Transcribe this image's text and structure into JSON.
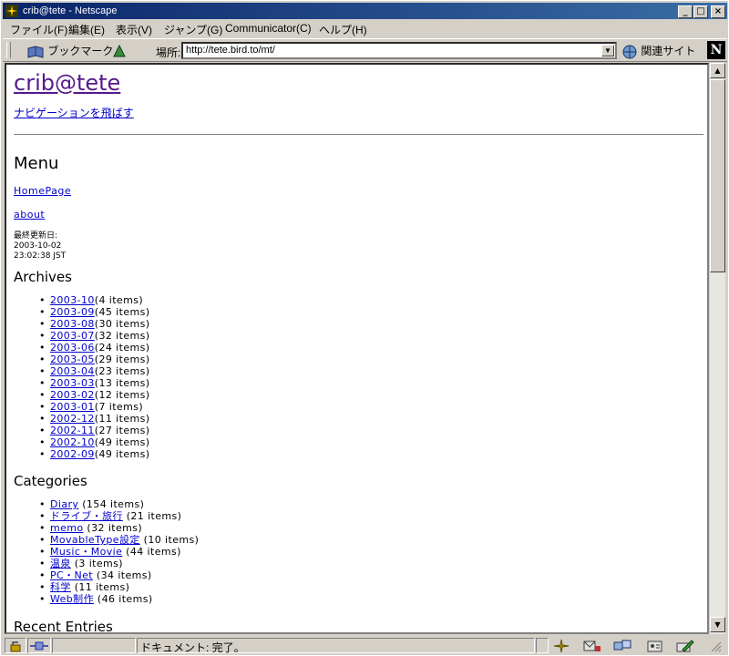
{
  "window": {
    "title": "crib@tete - Netscape"
  },
  "menubar": [
    "ファイル(F)",
    "編集(E)",
    "表示(V)",
    "ジャンプ(G)",
    "Communicator(C)",
    "ヘルプ(H)"
  ],
  "toolbar": {
    "bookmarks_label": "ブックマーク",
    "location_label": "場所:",
    "url": "http://tete.bird.to/mt/",
    "related_label": "関連サイト"
  },
  "page": {
    "site_title": "crib@tete",
    "skip_nav": "ナビゲーションを飛ばす",
    "menu_heading": "Menu",
    "menu_links": [
      "HomePage",
      "about"
    ],
    "last_updated_label": "最終更新日:",
    "last_updated_date": "2003-10-02",
    "last_updated_time": "23:02:38 JST",
    "archives_heading": "Archives",
    "archives": [
      {
        "label": "2003-10",
        "count": "(4 items)"
      },
      {
        "label": "2003-09",
        "count": "(45 items)"
      },
      {
        "label": "2003-08",
        "count": "(30 items)"
      },
      {
        "label": "2003-07",
        "count": "(32 items)"
      },
      {
        "label": "2003-06",
        "count": "(24 items)"
      },
      {
        "label": "2003-05",
        "count": "(29 items)"
      },
      {
        "label": "2003-04",
        "count": "(23 items)"
      },
      {
        "label": "2003-03",
        "count": "(13 items)"
      },
      {
        "label": "2003-02",
        "count": "(12 items)"
      },
      {
        "label": "2003-01",
        "count": "(7 items)"
      },
      {
        "label": "2002-12",
        "count": "(11 items)"
      },
      {
        "label": "2002-11",
        "count": "(27 items)"
      },
      {
        "label": "2002-10",
        "count": "(49 items)"
      },
      {
        "label": "2002-09",
        "count": "(49 items)"
      }
    ],
    "categories_heading": "Categories",
    "categories": [
      {
        "label": "Diary",
        "count": " (154 items)"
      },
      {
        "label": "ドライブ・旅行",
        "count": " (21 items)"
      },
      {
        "label": "memo",
        "count": " (32 items)"
      },
      {
        "label": "MovableType設定",
        "count": " (10 items)"
      },
      {
        "label": "Music・Movie",
        "count": " (44 items)"
      },
      {
        "label": "温泉",
        "count": " (3 items)"
      },
      {
        "label": "PC・Net",
        "count": " (34 items)"
      },
      {
        "label": "科学",
        "count": " (11 items)"
      },
      {
        "label": "Web制作",
        "count": " (46 items)"
      }
    ],
    "recent_heading": "Recent Entries"
  },
  "status": {
    "text": "ドキュメント: 完了。"
  },
  "colors": {
    "titlebar": "#0a246a",
    "link": "#0000cc",
    "visited": "#551a8b"
  }
}
